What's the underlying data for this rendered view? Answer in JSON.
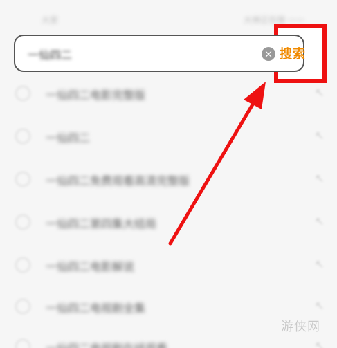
{
  "header": {
    "left_text": "大家",
    "right_text": "大神正在搜 一一"
  },
  "search": {
    "value": "一仙四二",
    "clear_icon": "clear-icon",
    "button_label": "搜索",
    "button_color": "#f08a00"
  },
  "suggestions": [
    {
      "text": "一仙四二电影完整版",
      "icon": "search-history-icon"
    },
    {
      "text": "一仙四二",
      "icon": "search-history-icon"
    },
    {
      "text": "一仙四二免费观看高清完整版",
      "icon": "search-history-icon"
    },
    {
      "text": "一仙四二第四集大结局",
      "icon": "search-history-icon"
    },
    {
      "text": "一仙四二电影解说",
      "icon": "search-history-icon"
    },
    {
      "text": "一仙四二电视剧全集",
      "icon": "search-history-icon"
    },
    {
      "text": "一仙四二电视剧在线观看",
      "icon": "search-history-icon"
    }
  ],
  "annotation": {
    "color": "#ee1111",
    "type": "red-arrow-pointing-to-search-button"
  },
  "watermark": "游侠网"
}
